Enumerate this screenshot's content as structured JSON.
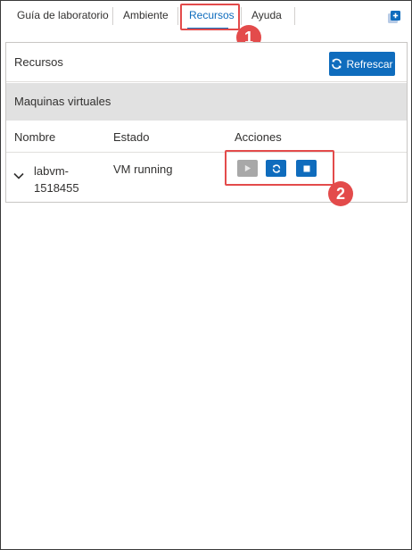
{
  "tabs": [
    {
      "label": "Guía de laboratorio"
    },
    {
      "label": "Ambiente"
    },
    {
      "label": "Recursos"
    },
    {
      "label": "Ayuda"
    }
  ],
  "active_tab": "Recursos",
  "annotations": {
    "badge1": "1",
    "badge2": "2"
  },
  "panel": {
    "title": "Recursos",
    "refresh_label": "Refrescar",
    "section_title": "Maquinas virtuales",
    "columns": {
      "name": "Nombre",
      "state": "Estado",
      "actions": "Acciones"
    },
    "vm": {
      "name_line1": "labvm-",
      "name_line2": "1518455",
      "state": "VM running"
    }
  },
  "colors": {
    "accent": "#0f6cbd",
    "annotation": "#e34b4b",
    "disabled": "#a8a8a8",
    "section_bg": "#e1e1e1"
  },
  "icons": {
    "corner": "add-window-icon",
    "refresh": "refresh-icon",
    "expand": "chevron-down-icon",
    "start": "play-icon",
    "restart": "refresh-icon",
    "stop": "stop-icon"
  }
}
